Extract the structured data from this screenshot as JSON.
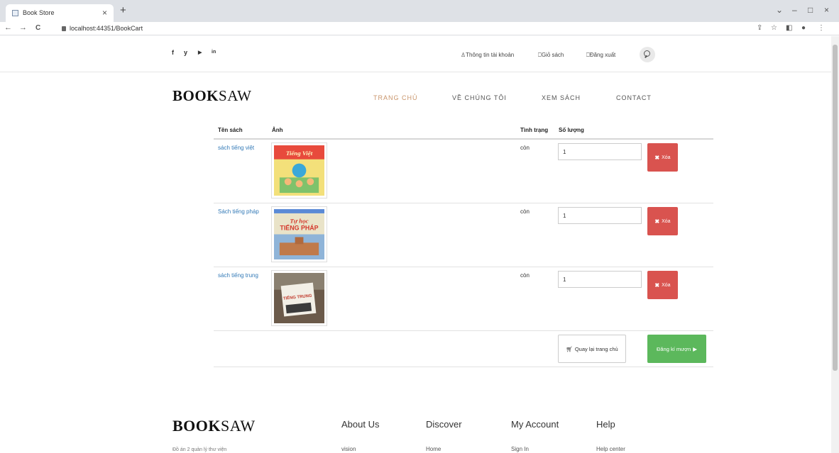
{
  "browser": {
    "tab_title": "Book Store",
    "tab_close": "×",
    "new_tab": "+",
    "url": "localhost:44351/BookCart",
    "back": "←",
    "forward": "→",
    "reload": "C",
    "win_chevron": "⌄",
    "win_min": "–",
    "win_max": "□",
    "win_close": "×",
    "share_icon": "⇪",
    "star_icon": "☆",
    "panel_icon": "◧",
    "profile_icon": "●",
    "menu_icon": "⋮"
  },
  "topbar": {
    "social": [
      "f",
      "y",
      "▶",
      "in"
    ],
    "account": "Thông tin tài khoản",
    "cart": "Giỏ sách",
    "logout": "Đăng xuất"
  },
  "logo": {
    "bold": "BOOK",
    "light": "SAW"
  },
  "menu": [
    "TRANG CHỦ",
    "VỀ CHÚNG TÔI",
    "XEM SÁCH",
    "CONTACT"
  ],
  "table": {
    "headers": {
      "name": "Tên sách",
      "image": "Ảnh",
      "status": "Tình trạng",
      "qty": "Số lượng"
    },
    "rows": [
      {
        "name": "sách tiếng việt",
        "status": "còn",
        "qty": "1",
        "delete": "Xóa",
        "cover_text": "Tiếng Việt"
      },
      {
        "name": "Sách tiếng pháp",
        "status": "còn",
        "qty": "1",
        "delete": "Xóa",
        "cover_text": "TIẾNG PHÁP"
      },
      {
        "name": "sách tiếng trung",
        "status": "còn",
        "qty": "1",
        "delete": "Xóa",
        "cover_text": "TIẾNG TRUNG"
      }
    ],
    "home_button": "Quay lại trang chủ",
    "borrow_button": "Đăng kí mượn"
  },
  "footer": {
    "headings": [
      "About Us",
      "Discover",
      "My Account",
      "Help"
    ],
    "links": [
      "vision",
      "Home",
      "Sign In",
      "Help center"
    ],
    "desc": "Đồ án 2 quản lý thư viện"
  },
  "colors": {
    "accent": "#c9956b",
    "link": "#337ab7",
    "danger": "#d9534f",
    "success": "#5cb85c"
  }
}
